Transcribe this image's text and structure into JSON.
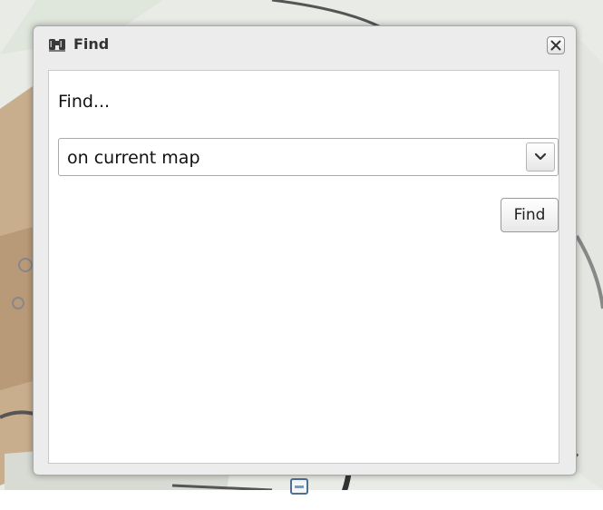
{
  "dialog": {
    "title": "Find",
    "title_icon": "binoculars-icon",
    "close_icon": "close-icon"
  },
  "form": {
    "prompt_label": "Find...",
    "scope_select": {
      "selected_value": "on current map",
      "arrow_icon": "chevron-down-icon"
    },
    "find_button_label": "Find"
  },
  "colors": {
    "dialog_frame": "#ececec",
    "dialog_border": "#a9a9a9",
    "content_background": "#ffffff",
    "map_background": "#e9ece6"
  }
}
